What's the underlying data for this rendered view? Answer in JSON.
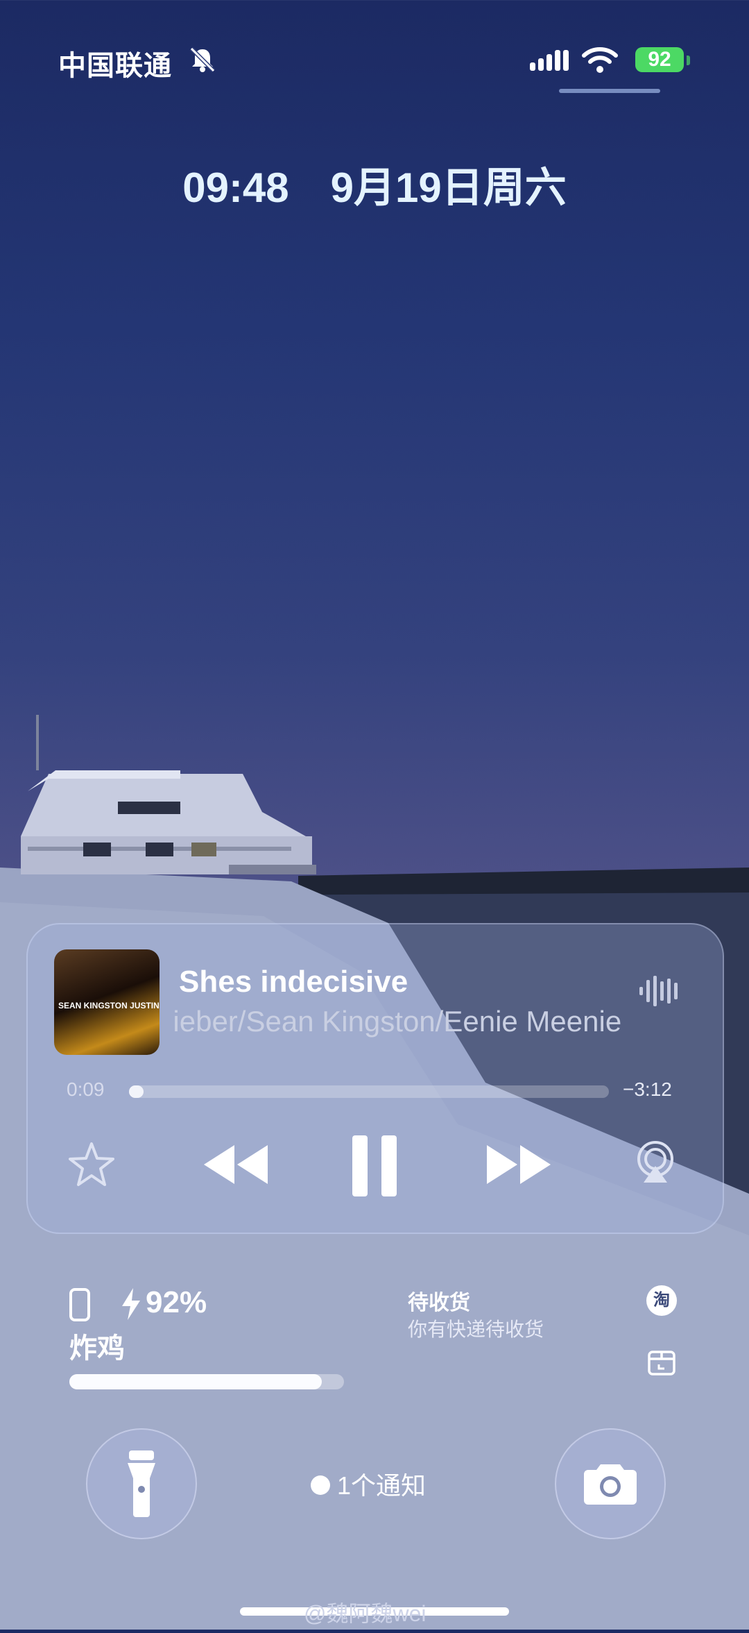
{
  "status_bar": {
    "carrier": "中国联通",
    "battery_level": "92",
    "battery_color": "#4cd964"
  },
  "lock_header": {
    "time": "09:48",
    "date": "9月19日周六"
  },
  "music_widget": {
    "song_title": "Shes indecisive",
    "artist_line": "Justin Bieber/Sean Kingston/Eenie Meenie",
    "cover_text": "SEAN KINGSTON JUSTIN BIEBER",
    "elapsed": "0:09",
    "remaining": "−3:12",
    "progress": 0.03,
    "controls": [
      "star-icon",
      "rewind-icon",
      "pause-icon",
      "fast-forward-icon",
      "airplay-icon"
    ]
  },
  "battery_widget": {
    "percent": "92%",
    "level": 0.92,
    "device_name": "炸鸡"
  },
  "package_widget": {
    "title": "待收货",
    "subtitle": "你有快递待收货",
    "app_badge": "淘"
  },
  "notifications": {
    "count_label": "1个通知"
  },
  "watermark": "@魏阿魏wei",
  "colors": {
    "accent": "#4cd964",
    "time_color": "#e4f3ff",
    "glass": "rgba(160,175,220,.32)"
  }
}
